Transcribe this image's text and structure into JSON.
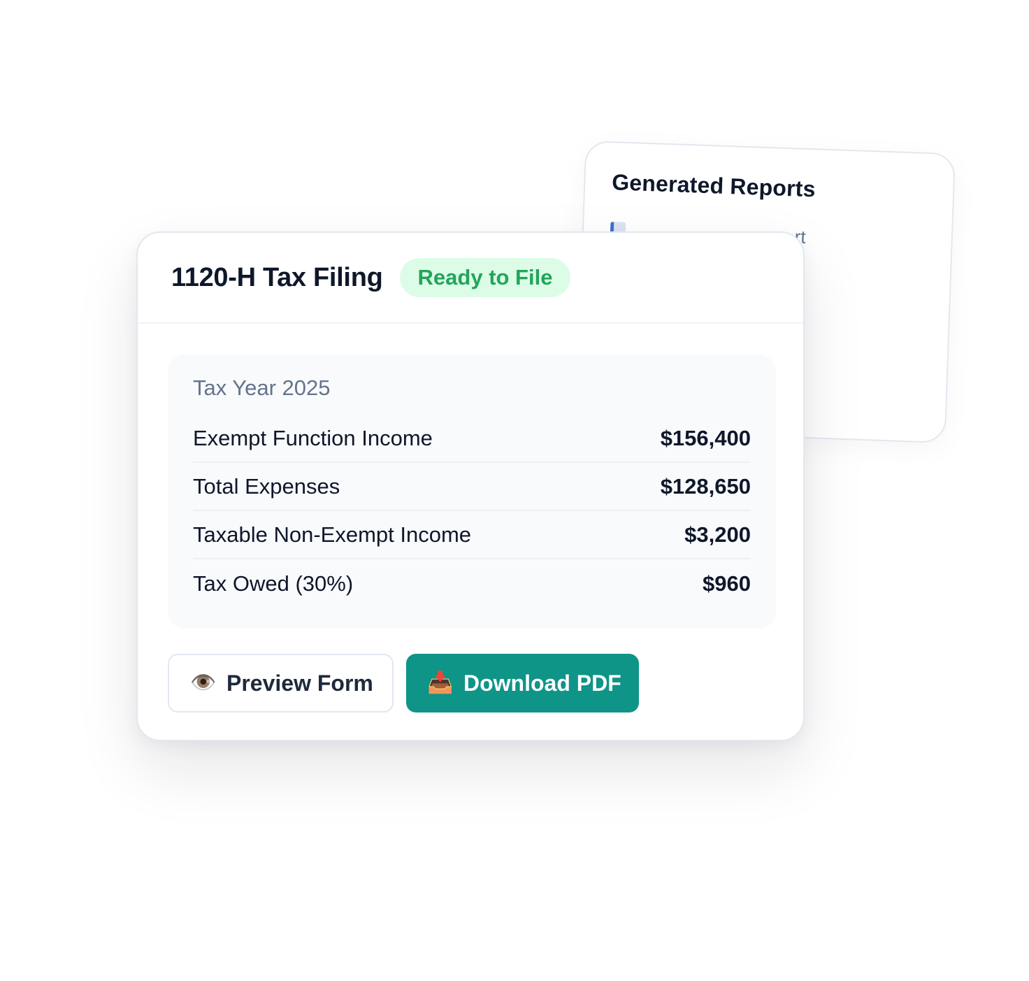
{
  "reports_card": {
    "title": "Generated Reports",
    "item_visible_text": "rt",
    "item_icon": "document-icon"
  },
  "filing": {
    "title": "1120-H Tax Filing",
    "status": "Ready to File",
    "tax_year": "Tax Year 2025",
    "rows": [
      {
        "label": "Exempt Function Income",
        "value": "$156,400"
      },
      {
        "label": "Total Expenses",
        "value": "$128,650"
      },
      {
        "label": "Taxable Non-Exempt Income",
        "value": "$3,200"
      },
      {
        "label": "Tax Owed (30%)",
        "value": "$960"
      }
    ]
  },
  "actions": {
    "preview_label": "Preview Form",
    "preview_icon": "👁️",
    "download_label": "Download PDF",
    "download_icon": "📥"
  },
  "colors": {
    "accent": "#0f9488",
    "badge_bg": "#dcfce7",
    "badge_text": "#22a55a",
    "muted_text": "#64748b"
  }
}
